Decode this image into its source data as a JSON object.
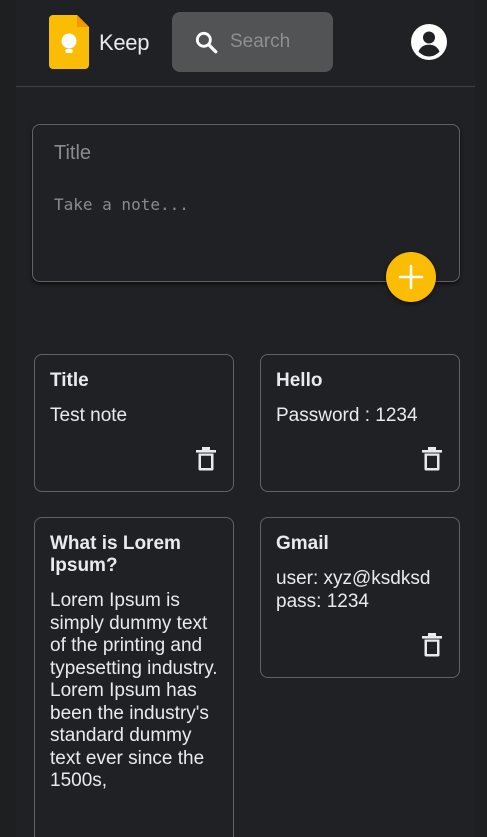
{
  "header": {
    "brand": "Keep",
    "search_placeholder": "Search"
  },
  "composer": {
    "title_placeholder": "Title",
    "body_placeholder": "Take a note..."
  },
  "notes": [
    {
      "title": "Title",
      "body": "Test note"
    },
    {
      "title": "Hello",
      "body": "Password : 1234"
    },
    {
      "title": "What is Lorem Ipsum?",
      "body": "Lorem Ipsum is simply dummy text of the printing and typesetting industry. Lorem Ipsum has been the industry's standard dummy text ever since the 1500s,"
    },
    {
      "title": "Gmail",
      "body": "user: xyz@ksdksd\npass: 1234"
    }
  ],
  "colors": {
    "background": "#202124",
    "accent": "#fbbc04",
    "search_bg": "#525355",
    "border": "#5f6368"
  },
  "icons": [
    "keep-logo-icon",
    "search-icon",
    "account-circle-icon",
    "plus-icon",
    "trash-icon"
  ]
}
